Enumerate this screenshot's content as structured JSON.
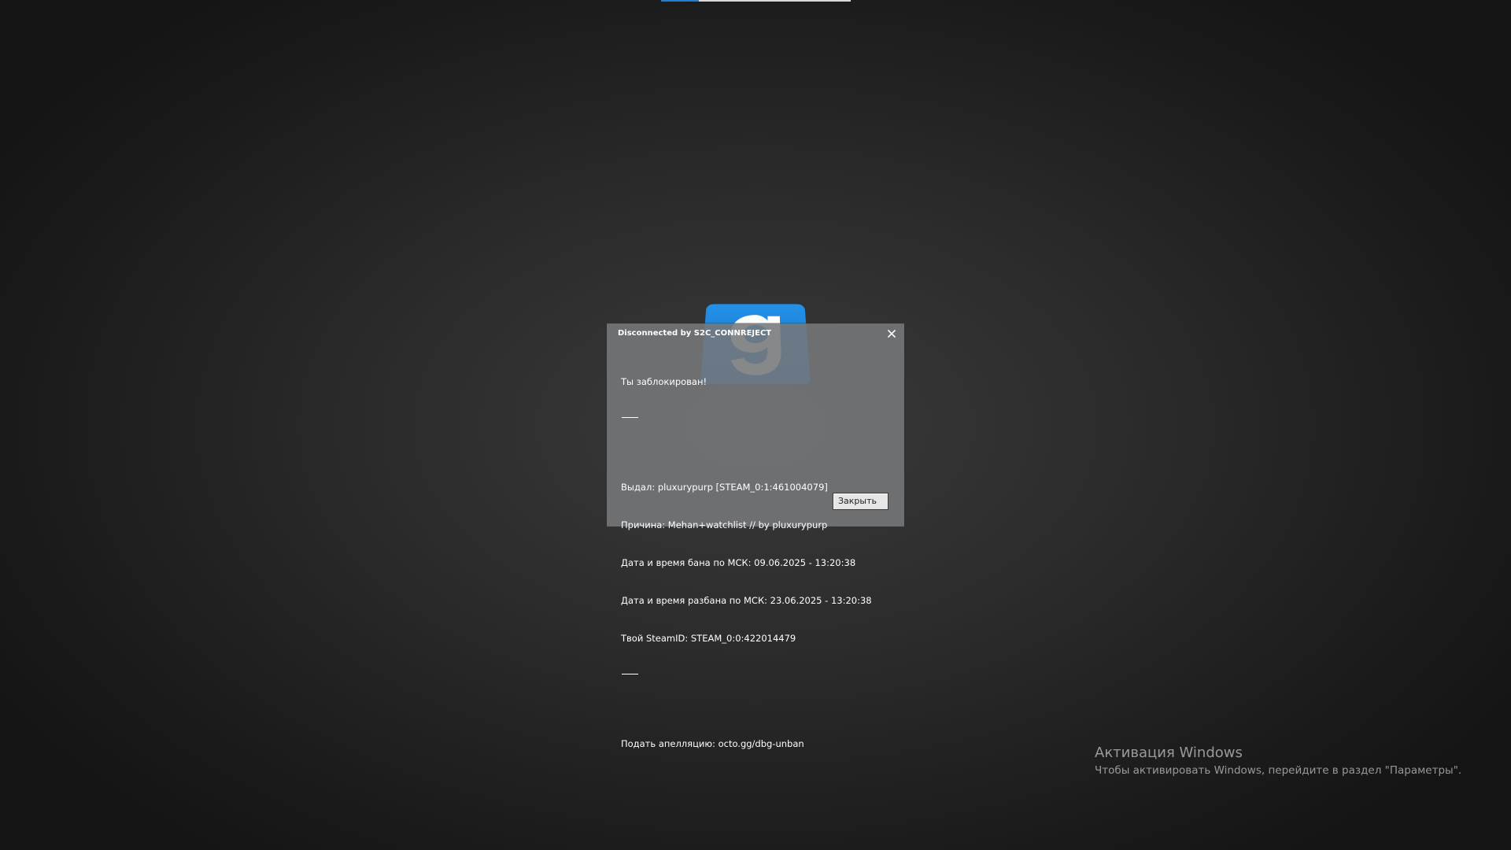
{
  "loading": {
    "progress": 0.2,
    "accent_color": "#1e7fd6"
  },
  "logo": {
    "icon": "gmod-logo-icon",
    "brand_color": "#1a83e0"
  },
  "dialog": {
    "title": "Disconnected by S2C_CONNREJECT",
    "close_icon": "close-icon",
    "message": {
      "header": "Ты заблокирован!",
      "separator": "——",
      "issued_by": "Выдал: pluxurypurp [STEAM_0:1:461004079]",
      "reason": "Причина: Mehan+watchlist // by pluxurypurp",
      "ban_date": "Дата и время бана по МСК: 09.06.2025 - 13:20:38",
      "unban_date": "Дата и время разбана по МСК: 23.06.2025 - 13:20:38",
      "steam_id": "Твой SteamID: STEAM_0:0:422014479",
      "appeal": "Подать апелляцию: octo.gg/dbg-unban"
    },
    "close_button_label": "Закрыть"
  },
  "watermark": {
    "title": "Активация Windows",
    "subtitle": "Чтобы активировать Windows, перейдите в раздел \"Параметры\"."
  }
}
